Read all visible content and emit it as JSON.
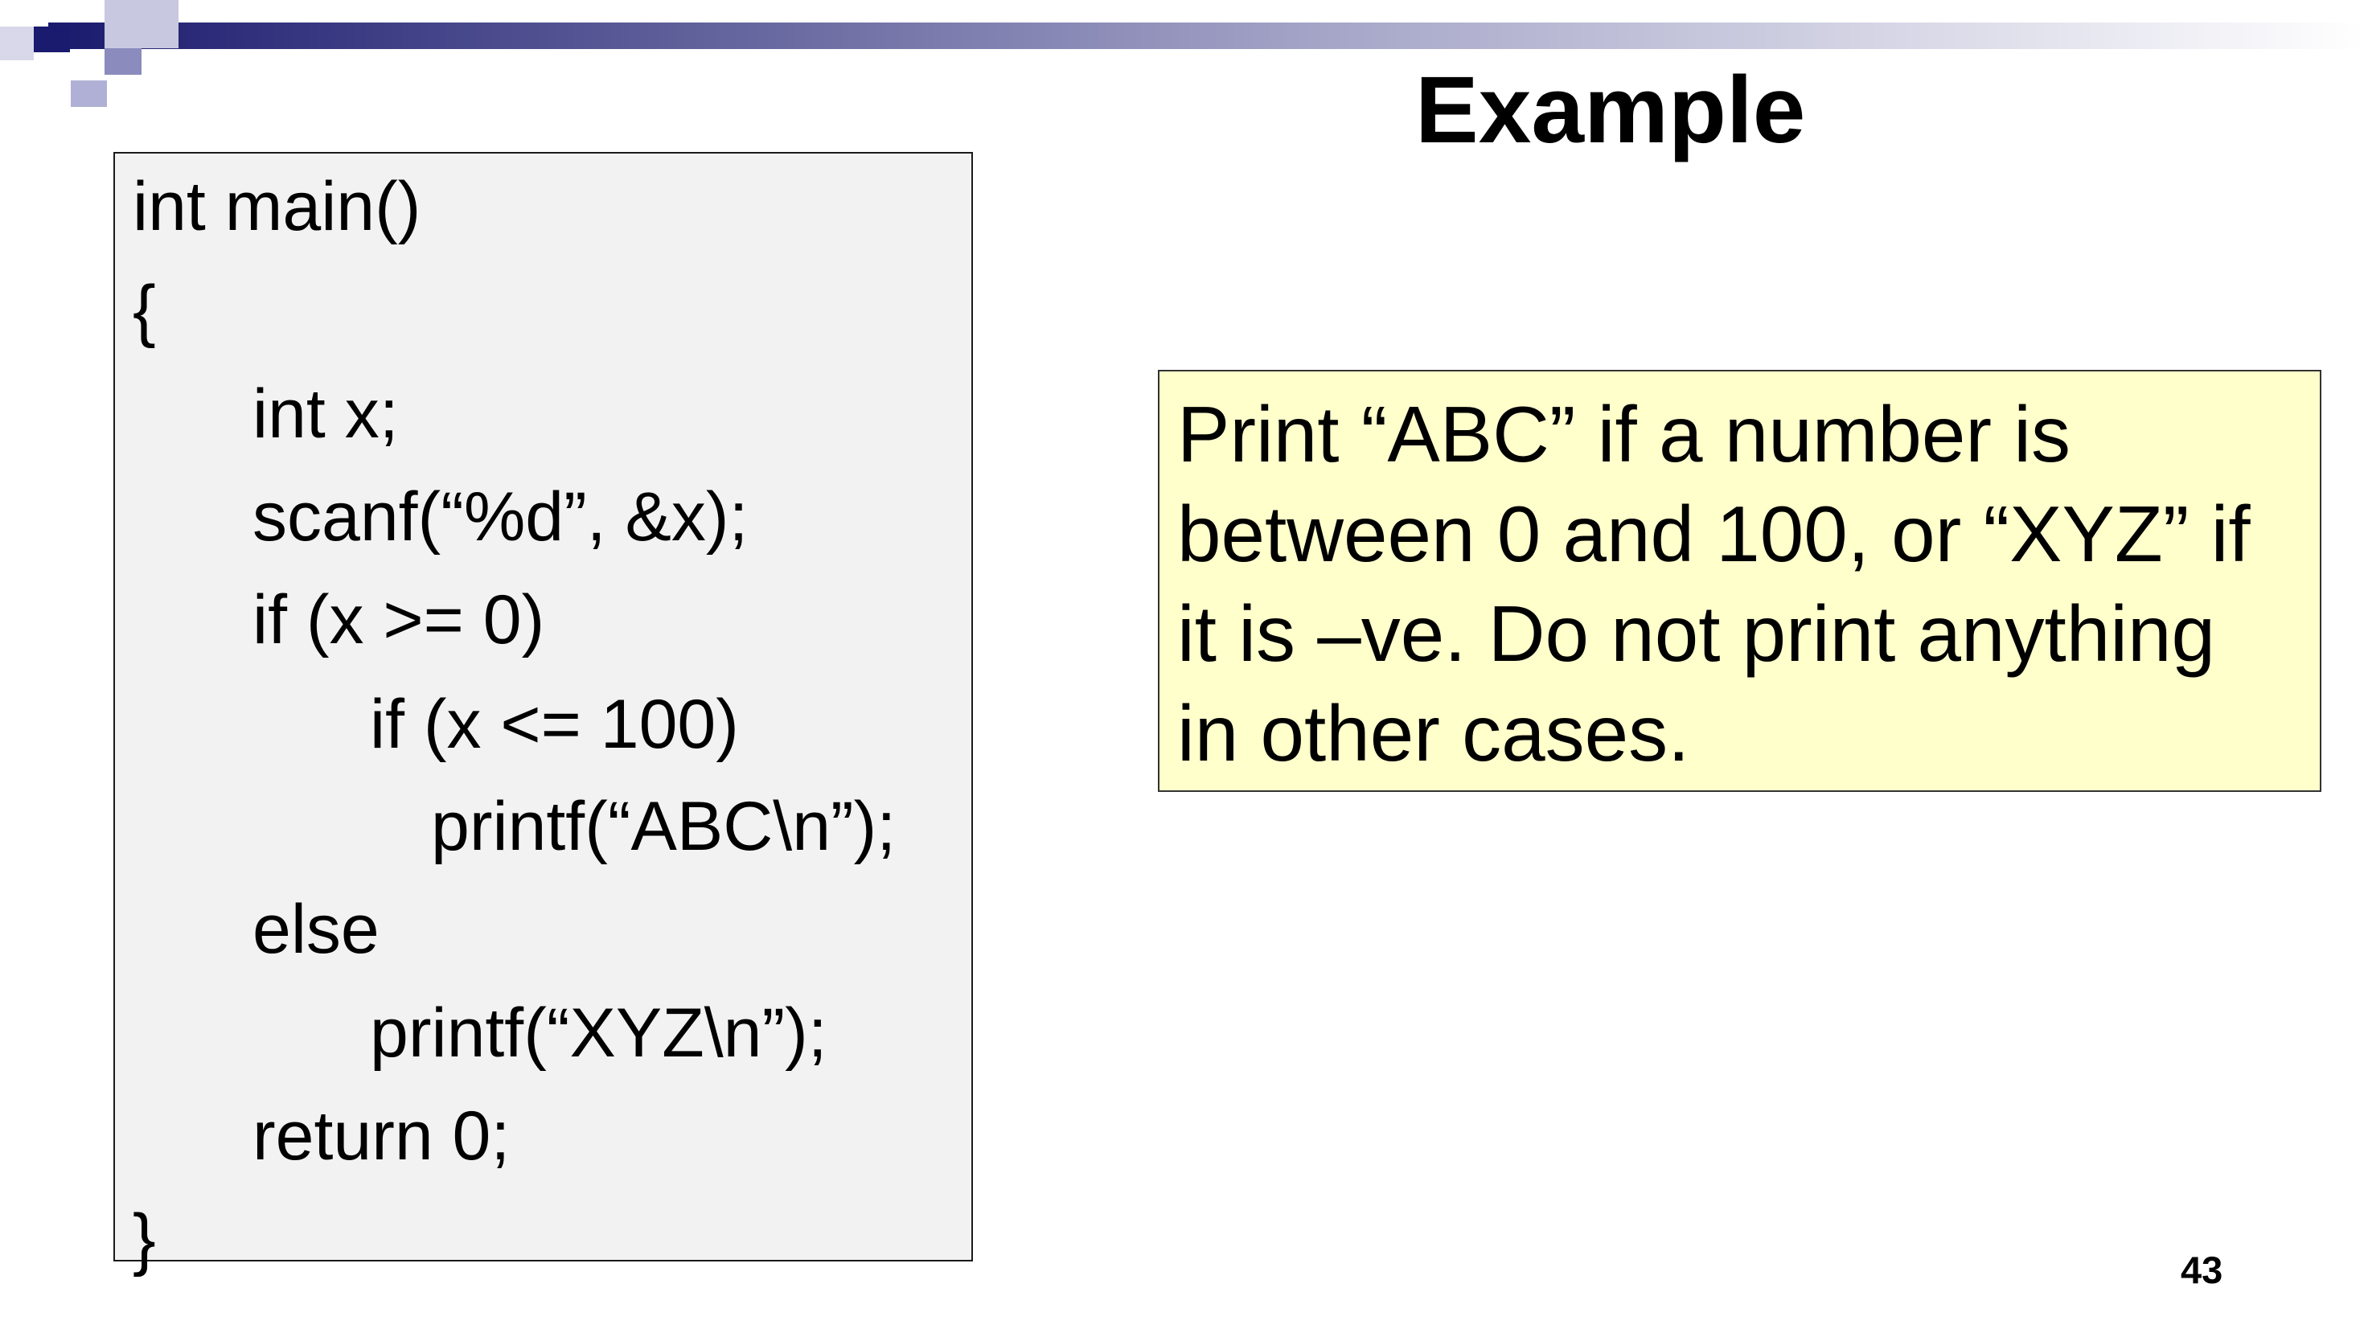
{
  "slide": {
    "title": "Example",
    "page_number": "43"
  },
  "code": {
    "lines": [
      "int main()",
      "{",
      "int x;",
      "scanf(“%d”, &x);",
      "if (x >= 0)",
      "if (x <= 100)",
      "printf(“ABC\\n”);",
      "else",
      "printf(“XYZ\\n”);",
      "return 0;",
      "}"
    ]
  },
  "note": {
    "lines": [
      "Print “ABC” if a number is",
      "between 0 and 100, or “XYZ” if",
      "it is –ve. Do not print anything",
      "in other cases."
    ]
  },
  "colors": {
    "deco_dark": "#1a1a6e",
    "deco_mid": "#4a4a9a",
    "deco_light": "#b0b0d6",
    "code_bg": "#f2f2f2",
    "note_bg": "#ffffcc"
  }
}
